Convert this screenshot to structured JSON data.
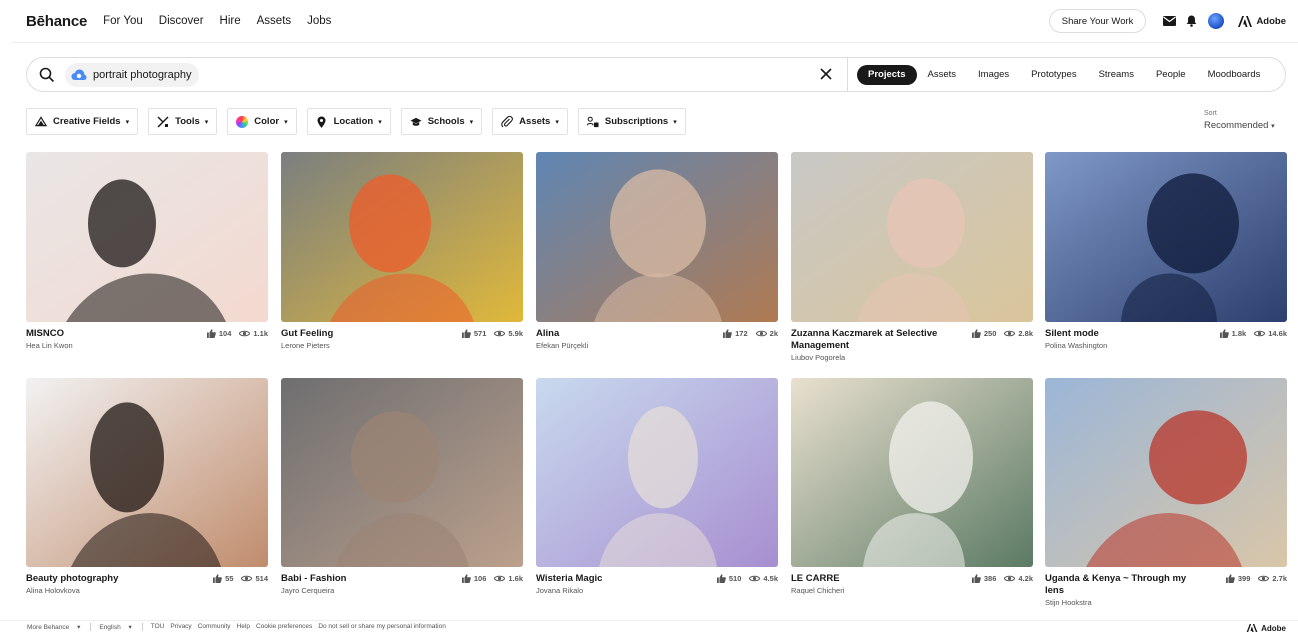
{
  "nav": {
    "logo": "Bēhance",
    "links": [
      "For You",
      "Discover",
      "Hire",
      "Assets",
      "Jobs"
    ],
    "share_label": "Share Your Work",
    "adobe_label": "Adobe"
  },
  "search": {
    "query": "portrait photography",
    "tabs": [
      "Projects",
      "Assets",
      "Images",
      "Prototypes",
      "Streams",
      "People",
      "Moodboards"
    ],
    "active_tab": "Projects"
  },
  "filters": [
    {
      "label": "Creative Fields",
      "icon": "creative-fields-icon"
    },
    {
      "label": "Tools",
      "icon": "tools-icon"
    },
    {
      "label": "Color",
      "icon": "color-wheel-icon"
    },
    {
      "label": "Location",
      "icon": "location-pin-icon"
    },
    {
      "label": "Schools",
      "icon": "graduation-cap-icon"
    },
    {
      "label": "Assets",
      "icon": "paperclip-icon"
    },
    {
      "label": "Subscriptions",
      "icon": "subscriptions-icon"
    }
  ],
  "sort": {
    "label": "Sort",
    "value": "Recommended"
  },
  "projects": [
    {
      "title": "MISNCO",
      "owner": "Hea Lin Kwon",
      "likes": "104",
      "views": "1.1k",
      "palette": [
        "#e9e6e6",
        "#f3d9cf",
        "#1b1716"
      ]
    },
    {
      "title": "Gut Feeling",
      "owner": "Lerone Pieters",
      "likes": "571",
      "views": "5.9k",
      "palette": [
        "#7a7f80",
        "#e0b83a",
        "#ef5b2a"
      ]
    },
    {
      "title": "Alina",
      "owner": "Efekan Pürçekli",
      "likes": "172",
      "views": "2k",
      "palette": [
        "#5f86b4",
        "#b07a52",
        "#d9bba4"
      ]
    },
    {
      "title": "Zuzanna Kaczmarek at Selective Management",
      "owner": "Liubov Pogorela",
      "likes": "250",
      "views": "2.8k",
      "palette": [
        "#c9c8c6",
        "#d9c59a",
        "#e8c4b5"
      ]
    },
    {
      "title": "Silent mode",
      "owner": "Polina Washington",
      "likes": "1.8k",
      "views": "14.6k",
      "palette": [
        "#7f98c7",
        "#2c3f6e",
        "#0e1a3a"
      ]
    },
    {
      "title": "Beauty photography",
      "owner": "Alina Holovkova",
      "likes": "55",
      "views": "514",
      "palette": [
        "#f2f2f2",
        "#c08c6c",
        "#1f1512"
      ]
    },
    {
      "title": "Babi - Fashion",
      "owner": "Jayro Cerqueira",
      "likes": "106",
      "views": "1.6k",
      "palette": [
        "#6e6e70",
        "#bba08c",
        "#9b8474"
      ]
    },
    {
      "title": "Wisteria Magic",
      "owner": "Jovana Rikalo",
      "likes": "510",
      "views": "4.5k",
      "palette": [
        "#c8d9ee",
        "#a78fd0",
        "#e6ddd8"
      ]
    },
    {
      "title": "LE CARRE",
      "owner": "Raquel Chicheri",
      "likes": "386",
      "views": "4.2k",
      "palette": [
        "#e9e0cf",
        "#5b7a64",
        "#f3f2ee"
      ]
    },
    {
      "title": "Uganda & Kenya ~ Through my lens",
      "owner": "Stijn Hookstra",
      "likes": "399",
      "views": "2.7k",
      "palette": [
        "#9bb6d8",
        "#d9c6a8",
        "#b8352a"
      ]
    }
  ],
  "footer": {
    "more": "More Behance",
    "language": "English",
    "links": [
      "TOU",
      "Privacy",
      "Community",
      "Help",
      "Cookie preferences",
      "Do not sell or share my personal information"
    ],
    "adobe_label": "Adobe"
  }
}
